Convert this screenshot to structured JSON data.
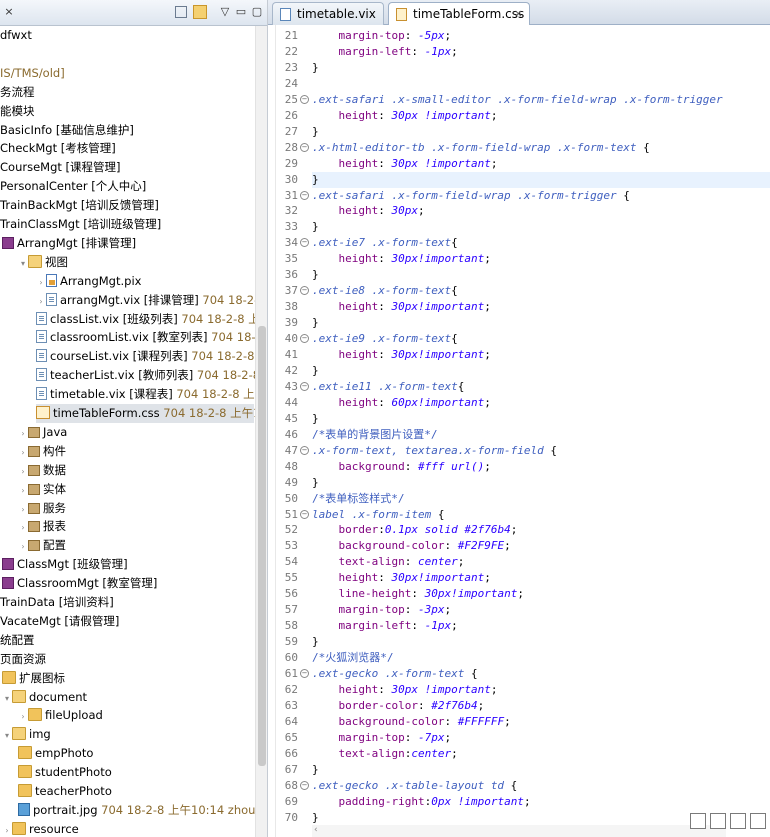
{
  "left_panel": {
    "title": "× ",
    "tree": [
      {
        "text": "dfwxt",
        "x": 0,
        "icon": "none"
      },
      {
        "text": "",
        "x": 0,
        "icon": "none"
      },
      {
        "text": "IS/TMS/old]",
        "x": 0,
        "icon": "none",
        "color": "#8a6a2e"
      },
      {
        "text": "务流程",
        "x": 0,
        "icon": "none"
      },
      {
        "text": "能模块",
        "x": 0,
        "icon": "none"
      },
      {
        "text": "BasicInfo [基础信息维护]",
        "x": 0,
        "icon": "none"
      },
      {
        "text": "CheckMgt [考核管理]",
        "x": 0,
        "icon": "none"
      },
      {
        "text": "CourseMgt [课程管理]",
        "x": 0,
        "icon": "none"
      },
      {
        "text": "PersonalCenter [个人中心]",
        "x": 0,
        "icon": "none"
      },
      {
        "text": "TrainBackMgt [培训反馈管理]",
        "x": 0,
        "icon": "none"
      },
      {
        "text": "TrainClassMgt [培训班级管理]",
        "x": 0,
        "icon": "none"
      },
      {
        "text": "ArrangMgt [排课管理]",
        "x": 2,
        "icon": "module",
        "twist": ""
      },
      {
        "text": "视图",
        "x": 18,
        "icon": "folder",
        "twist": "▾"
      },
      {
        "text": "ArrangMgt.pix",
        "x": 36,
        "icon": "pix",
        "twist": "›"
      },
      {
        "text": "arrangMgt.vix [排课管理]",
        "meta": "704  18-2-8",
        "x": 36,
        "icon": "file",
        "twist": "›"
      },
      {
        "text": "classList.vix [班级列表]",
        "meta": "704  18-2-8 上",
        "x": 36,
        "icon": "file",
        "twist": ""
      },
      {
        "text": "classroomList.vix [教室列表]",
        "meta": "704  18-",
        "x": 36,
        "icon": "file",
        "twist": ""
      },
      {
        "text": "courseList.vix [课程列表]",
        "meta": "704  18-2-8",
        "x": 36,
        "icon": "file",
        "twist": ""
      },
      {
        "text": "teacherList.vix [教师列表]",
        "meta": "704  18-2-8",
        "x": 36,
        "icon": "file",
        "twist": ""
      },
      {
        "text": "timetable.vix [课程表]",
        "meta": "704  18-2-8 上午",
        "x": 36,
        "icon": "file",
        "twist": ""
      },
      {
        "text": "timeTableForm.css",
        "meta": "704  18-2-8 上午1",
        "x": 36,
        "icon": "css",
        "twist": "",
        "selected": true
      },
      {
        "text": "Java",
        "x": 18,
        "icon": "pkg",
        "twist": "›"
      },
      {
        "text": "构件",
        "x": 18,
        "icon": "pkg",
        "twist": "›"
      },
      {
        "text": "数据",
        "x": 18,
        "icon": "pkg",
        "twist": "›"
      },
      {
        "text": "实体",
        "x": 18,
        "icon": "pkg",
        "twist": "›"
      },
      {
        "text": "服务",
        "x": 18,
        "icon": "pkg",
        "twist": "›"
      },
      {
        "text": "报表",
        "x": 18,
        "icon": "pkg",
        "twist": "›"
      },
      {
        "text": "配置",
        "x": 18,
        "icon": "pkg",
        "twist": "›"
      },
      {
        "text": "ClassMgt [班级管理]",
        "x": 2,
        "icon": "module",
        "twist": ""
      },
      {
        "text": "ClassroomMgt [教室管理]",
        "x": 2,
        "icon": "module",
        "twist": ""
      },
      {
        "text": "TrainData [培训资料]",
        "x": 0,
        "icon": "none"
      },
      {
        "text": "VacateMgt [请假管理]",
        "x": 0,
        "icon": "none"
      },
      {
        "text": "统配置",
        "x": 0,
        "icon": "none"
      },
      {
        "text": "页面资源",
        "x": 0,
        "icon": "none"
      },
      {
        "text": "扩展图标",
        "x": 2,
        "icon": "folder",
        "twist": ""
      },
      {
        "text": "document",
        "x": 2,
        "icon": "folder",
        "twist": "▾"
      },
      {
        "text": "fileUpload",
        "x": 18,
        "icon": "folder",
        "twist": "›"
      },
      {
        "text": "img",
        "x": 2,
        "icon": "folder",
        "twist": "▾"
      },
      {
        "text": "empPhoto",
        "x": 18,
        "icon": "folder",
        "twist": ""
      },
      {
        "text": "studentPhoto",
        "x": 18,
        "icon": "folder",
        "twist": ""
      },
      {
        "text": "teacherPhoto",
        "x": 18,
        "icon": "folder",
        "twist": ""
      },
      {
        "text": "portrait.jpg",
        "meta": "704  18-2-8 上午10:14  zhou",
        "x": 18,
        "icon": "img",
        "twist": ""
      },
      {
        "text": "resource",
        "x": 2,
        "icon": "folder",
        "twist": "›"
      }
    ]
  },
  "editor": {
    "tabs": [
      {
        "label": "timetable.vix",
        "active": false
      },
      {
        "label": "timeTableForm.css",
        "active": true,
        "close": "×"
      }
    ],
    "lines": [
      {
        "n": "21",
        "fold": "",
        "parts": [
          [
            "b",
            "    "
          ],
          [
            "p",
            "margin-top"
          ],
          [
            "b",
            ": "
          ],
          [
            "v",
            "-5px"
          ],
          [
            "b",
            ";"
          ]
        ]
      },
      {
        "n": "22",
        "fold": "",
        "parts": [
          [
            "b",
            "    "
          ],
          [
            "p",
            "margin-left"
          ],
          [
            "b",
            ": "
          ],
          [
            "v",
            "-1px"
          ],
          [
            "b",
            ";"
          ]
        ]
      },
      {
        "n": "23",
        "fold": "",
        "parts": [
          [
            "b",
            "}"
          ]
        ]
      },
      {
        "n": "24",
        "fold": "",
        "parts": []
      },
      {
        "n": "25",
        "fold": "⊖",
        "parts": [
          [
            "s",
            ".ext-safari .x-small-editor .x-form-field-wrap .x-form-trigger"
          ]
        ]
      },
      {
        "n": "26",
        "fold": "",
        "parts": [
          [
            "b",
            "    "
          ],
          [
            "p",
            "height"
          ],
          [
            "b",
            ": "
          ],
          [
            "v",
            "30px !important"
          ],
          [
            "b",
            ";"
          ]
        ]
      },
      {
        "n": "27",
        "fold": "",
        "parts": [
          [
            "b",
            "}"
          ]
        ]
      },
      {
        "n": "28",
        "fold": "⊖",
        "parts": [
          [
            "s",
            ".x-html-editor-tb .x-form-field-wrap .x-form-text"
          ],
          [
            "b",
            " {"
          ]
        ]
      },
      {
        "n": "29",
        "fold": "",
        "parts": [
          [
            "b",
            "    "
          ],
          [
            "p",
            "height"
          ],
          [
            "b",
            ": "
          ],
          [
            "v",
            "30px !important"
          ],
          [
            "b",
            ";"
          ]
        ]
      },
      {
        "n": "30",
        "fold": "",
        "parts": [
          [
            "b",
            "}"
          ]
        ],
        "hl": true
      },
      {
        "n": "31",
        "fold": "⊖",
        "parts": [
          [
            "s",
            ".ext-safari .x-form-field-wrap .x-form-trigger"
          ],
          [
            "b",
            " {"
          ]
        ]
      },
      {
        "n": "32",
        "fold": "",
        "parts": [
          [
            "b",
            "    "
          ],
          [
            "p",
            "height"
          ],
          [
            "b",
            ": "
          ],
          [
            "v",
            "30px"
          ],
          [
            "b",
            ";"
          ]
        ]
      },
      {
        "n": "33",
        "fold": "",
        "parts": [
          [
            "b",
            "}"
          ]
        ]
      },
      {
        "n": "34",
        "fold": "⊖",
        "parts": [
          [
            "s",
            ".ext-ie7 .x-form-text"
          ],
          [
            "b",
            "{"
          ]
        ]
      },
      {
        "n": "35",
        "fold": "",
        "parts": [
          [
            "b",
            "    "
          ],
          [
            "p",
            "height"
          ],
          [
            "b",
            ": "
          ],
          [
            "v",
            "30px!important"
          ],
          [
            "b",
            ";"
          ]
        ]
      },
      {
        "n": "36",
        "fold": "",
        "parts": [
          [
            "b",
            "}"
          ]
        ]
      },
      {
        "n": "37",
        "fold": "⊖",
        "parts": [
          [
            "s",
            ".ext-ie8 .x-form-text"
          ],
          [
            "b",
            "{"
          ]
        ]
      },
      {
        "n": "38",
        "fold": "",
        "parts": [
          [
            "b",
            "    "
          ],
          [
            "p",
            "height"
          ],
          [
            "b",
            ": "
          ],
          [
            "v",
            "30px!important"
          ],
          [
            "b",
            ";"
          ]
        ]
      },
      {
        "n": "39",
        "fold": "",
        "parts": [
          [
            "b",
            "}"
          ]
        ]
      },
      {
        "n": "40",
        "fold": "⊖",
        "parts": [
          [
            "s",
            ".ext-ie9 .x-form-text"
          ],
          [
            "b",
            "{"
          ]
        ]
      },
      {
        "n": "41",
        "fold": "",
        "parts": [
          [
            "b",
            "    "
          ],
          [
            "p",
            "height"
          ],
          [
            "b",
            ": "
          ],
          [
            "v",
            "30px!important"
          ],
          [
            "b",
            ";"
          ]
        ]
      },
      {
        "n": "42",
        "fold": "",
        "parts": [
          [
            "b",
            "}"
          ]
        ]
      },
      {
        "n": "43",
        "fold": "⊖",
        "parts": [
          [
            "s",
            ".ext-ie11 .x-form-text"
          ],
          [
            "b",
            "{"
          ]
        ]
      },
      {
        "n": "44",
        "fold": "",
        "parts": [
          [
            "b",
            "    "
          ],
          [
            "p",
            "height"
          ],
          [
            "b",
            ": "
          ],
          [
            "v",
            "60px!important"
          ],
          [
            "b",
            ";"
          ]
        ]
      },
      {
        "n": "45",
        "fold": "",
        "parts": [
          [
            "b",
            "}"
          ]
        ]
      },
      {
        "n": "46",
        "fold": "",
        "parts": [
          [
            "c",
            "/*表单的背景图片设置*/"
          ]
        ]
      },
      {
        "n": "47",
        "fold": "⊖",
        "parts": [
          [
            "s",
            ".x-form-text, textarea.x-form-field"
          ],
          [
            "b",
            " {"
          ]
        ]
      },
      {
        "n": "48",
        "fold": "",
        "parts": [
          [
            "b",
            "    "
          ],
          [
            "p",
            "background"
          ],
          [
            "b",
            ": "
          ],
          [
            "v",
            "#fff url()"
          ],
          [
            "b",
            ";"
          ]
        ]
      },
      {
        "n": "49",
        "fold": "",
        "parts": [
          [
            "b",
            "}"
          ]
        ]
      },
      {
        "n": "50",
        "fold": "",
        "parts": [
          [
            "c",
            "/*表单标签样式*/"
          ]
        ]
      },
      {
        "n": "51",
        "fold": "⊖",
        "parts": [
          [
            "s",
            "label .x-form-item"
          ],
          [
            "b",
            " {"
          ]
        ]
      },
      {
        "n": "52",
        "fold": "",
        "parts": [
          [
            "b",
            "    "
          ],
          [
            "p",
            "border"
          ],
          [
            "b",
            ":"
          ],
          [
            "v",
            "0.1px solid #2f76b4"
          ],
          [
            "b",
            ";"
          ]
        ]
      },
      {
        "n": "53",
        "fold": "",
        "parts": [
          [
            "b",
            "    "
          ],
          [
            "p",
            "background-color"
          ],
          [
            "b",
            ": "
          ],
          [
            "v",
            "#F2F9FE"
          ],
          [
            "b",
            ";"
          ]
        ]
      },
      {
        "n": "54",
        "fold": "",
        "parts": [
          [
            "b",
            "    "
          ],
          [
            "p",
            "text-align"
          ],
          [
            "b",
            ": "
          ],
          [
            "v",
            "center"
          ],
          [
            "b",
            ";"
          ]
        ]
      },
      {
        "n": "55",
        "fold": "",
        "parts": [
          [
            "b",
            "    "
          ],
          [
            "p",
            "height"
          ],
          [
            "b",
            ": "
          ],
          [
            "v",
            "30px!important"
          ],
          [
            "b",
            ";"
          ]
        ]
      },
      {
        "n": "56",
        "fold": "",
        "parts": [
          [
            "b",
            "    "
          ],
          [
            "p",
            "line-height"
          ],
          [
            "b",
            ": "
          ],
          [
            "v",
            "30px!important"
          ],
          [
            "b",
            ";"
          ]
        ]
      },
      {
        "n": "57",
        "fold": "",
        "parts": [
          [
            "b",
            "    "
          ],
          [
            "p",
            "margin-top"
          ],
          [
            "b",
            ": "
          ],
          [
            "v",
            "-3px"
          ],
          [
            "b",
            ";"
          ]
        ]
      },
      {
        "n": "58",
        "fold": "",
        "parts": [
          [
            "b",
            "    "
          ],
          [
            "p",
            "margin-left"
          ],
          [
            "b",
            ": "
          ],
          [
            "v",
            "-1px"
          ],
          [
            "b",
            ";"
          ]
        ]
      },
      {
        "n": "59",
        "fold": "",
        "parts": [
          [
            "b",
            "}"
          ]
        ]
      },
      {
        "n": "60",
        "fold": "",
        "parts": [
          [
            "c",
            "/*火狐浏览器*/"
          ]
        ]
      },
      {
        "n": "61",
        "fold": "⊖",
        "parts": [
          [
            "s",
            ".ext-gecko .x-form-text"
          ],
          [
            "b",
            " {"
          ]
        ]
      },
      {
        "n": "62",
        "fold": "",
        "parts": [
          [
            "b",
            "    "
          ],
          [
            "p",
            "height"
          ],
          [
            "b",
            ": "
          ],
          [
            "v",
            "30px !important"
          ],
          [
            "b",
            ";"
          ]
        ]
      },
      {
        "n": "63",
        "fold": "",
        "parts": [
          [
            "b",
            "    "
          ],
          [
            "p",
            "border-color"
          ],
          [
            "b",
            ": "
          ],
          [
            "v",
            "#2f76b4"
          ],
          [
            "b",
            ";"
          ]
        ]
      },
      {
        "n": "64",
        "fold": "",
        "parts": [
          [
            "b",
            "    "
          ],
          [
            "p",
            "background-color"
          ],
          [
            "b",
            ": "
          ],
          [
            "v",
            "#FFFFFF"
          ],
          [
            "b",
            ";"
          ]
        ]
      },
      {
        "n": "65",
        "fold": "",
        "parts": [
          [
            "b",
            "    "
          ],
          [
            "p",
            "margin-top"
          ],
          [
            "b",
            ": "
          ],
          [
            "v",
            "-7px"
          ],
          [
            "b",
            ";"
          ]
        ]
      },
      {
        "n": "66",
        "fold": "",
        "parts": [
          [
            "b",
            "    "
          ],
          [
            "p",
            "text-align"
          ],
          [
            "b",
            ":"
          ],
          [
            "v",
            "center"
          ],
          [
            "b",
            ";"
          ]
        ]
      },
      {
        "n": "67",
        "fold": "",
        "parts": [
          [
            "b",
            "}"
          ]
        ]
      },
      {
        "n": "68",
        "fold": "⊖",
        "parts": [
          [
            "s",
            ".ext-gecko .x-table-layout"
          ],
          [
            "b",
            " "
          ],
          [
            "s",
            "td"
          ],
          [
            "b",
            " {"
          ]
        ]
      },
      {
        "n": "69",
        "fold": "",
        "parts": [
          [
            "b",
            "    "
          ],
          [
            "p",
            "padding-right"
          ],
          [
            "b",
            ":"
          ],
          [
            "v",
            "0px !important"
          ],
          [
            "b",
            ";"
          ]
        ]
      },
      {
        "n": "70",
        "fold": "",
        "parts": [
          [
            "b",
            "}"
          ]
        ]
      }
    ]
  },
  "icons": {
    "minimize": "minimize-icon",
    "maximize": "maximize-icon",
    "view_menu": "view-menu-icon"
  }
}
